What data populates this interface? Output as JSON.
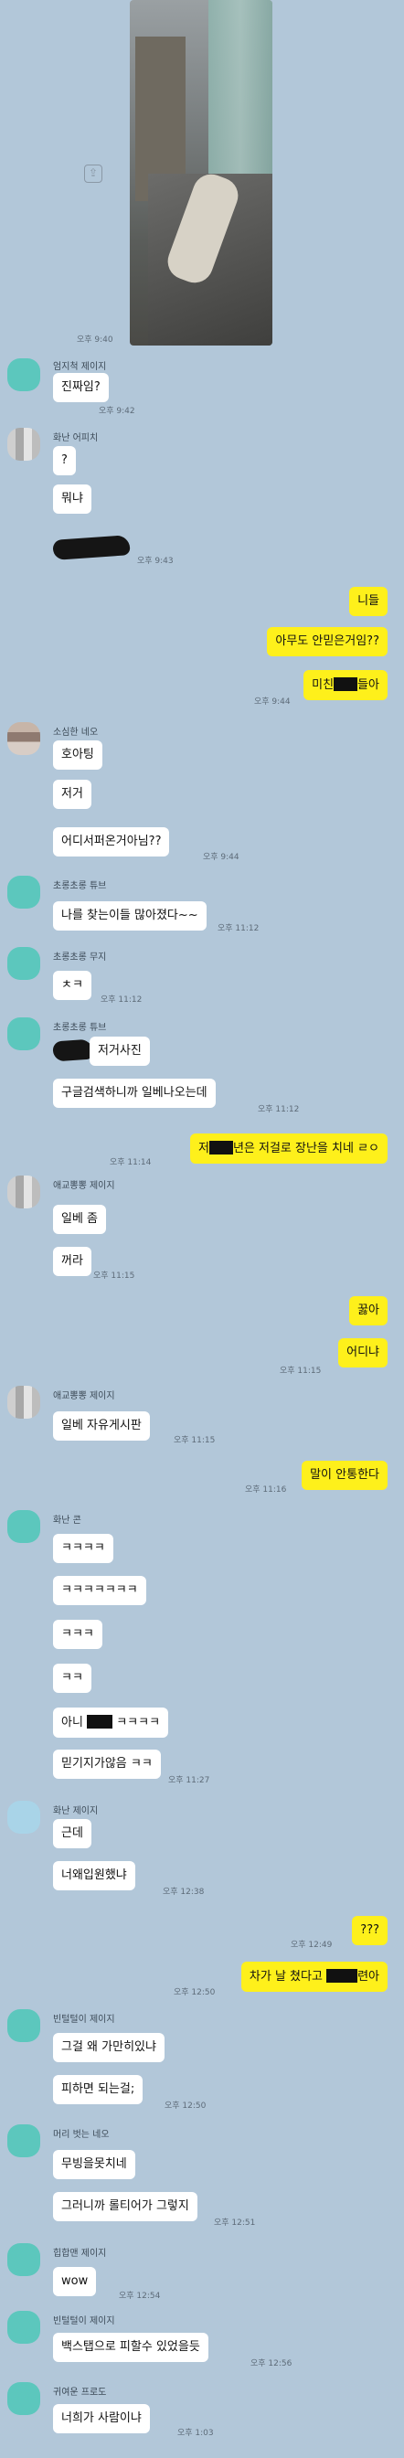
{
  "photo_time": "오후 9:40",
  "messages": [
    {
      "name": "엄지척 제이지",
      "bubbles": [
        "진짜임?"
      ],
      "time": "오후 9:42"
    },
    {
      "name": "화난 어피치",
      "bubbles": [
        "?",
        "뭐냐"
      ],
      "time": "오후 9:43"
    },
    {
      "mine": [
        "니들",
        "아무도 안믿은거임??",
        "미친",
        "들아"
      ],
      "time": "오후 9:44"
    },
    {
      "name": "소심한 네오",
      "bubbles": [
        "호아팅",
        "저거",
        "어디서퍼온거아님??"
      ],
      "time": "오후 9:44"
    },
    {
      "name": "초롱초롱 튜브",
      "bubbles": [
        "나를 찾는이들 많아졌다~~"
      ],
      "time": "오후 11:12"
    },
    {
      "name": "초롱초롱 무지",
      "bubbles": [
        "ㅊㅋ"
      ],
      "time": "오후 11:12"
    },
    {
      "name": "초롱초롱 튜브",
      "bubbles": [
        "저거사진",
        "구글검색하니까 일베나오는데"
      ],
      "time": "오후 11:12"
    },
    {
      "mine_time": "오후 11:14",
      "mine": [
        "저",
        "년은 저걸로 장난을 치네 ㄹㅇ"
      ]
    },
    {
      "name": "애교뽕뽕 제이지",
      "bubbles": [
        "일베 좀",
        "꺼라"
      ],
      "time": "오후 11:15"
    },
    {
      "mine": [
        "꿇아",
        "어디냐"
      ],
      "time": "오후 11:15"
    },
    {
      "name": "애교뽕뽕 제이지",
      "bubbles": [
        "일베 자유게시판"
      ],
      "time": "오후 11:15"
    },
    {
      "mine": [
        "말이 안통한다"
      ],
      "time": "오후 11:16"
    },
    {
      "name": "화난 콘",
      "bubbles": [
        "ㅋㅋㅋㅋ",
        "ㅋㅋㅋㅋㅋㅋㅋ",
        "ㅋㅋㅋ",
        "ㅋㅋ",
        "아니",
        "ㅋㅋㅋㅋ",
        "믿기지가않음 ㅋㅋ"
      ],
      "time": "오후 11:27"
    },
    {
      "name": "화난 제이지",
      "bubbles": [
        "근데",
        "너왜입원했냐"
      ],
      "time": "오후 12:38"
    },
    {
      "mine": [
        "???"
      ],
      "time": "오후 12:49"
    },
    {
      "mine": [
        "차가 날 쳤다고",
        "련아"
      ],
      "time": "오후 12:50"
    },
    {
      "name": "빈털털이 제이지",
      "bubbles": [
        "그걸 왜 가만히있냐",
        "피하면 되는걸;"
      ],
      "time": "오후 12:50"
    },
    {
      "name": "머리 벗는 네오",
      "bubbles": [
        "무빙을못치네",
        "그러니까 롤티어가 그렇지"
      ],
      "time": "오후 12:51"
    },
    {
      "name": "힙합맨 제이지",
      "bubbles": [
        "wow"
      ],
      "time": "오후 12:54"
    },
    {
      "name": "빈털털이 제이지",
      "bubbles": [
        "백스탭으로 피할수 있었을듯"
      ],
      "time": "오후 12:56"
    },
    {
      "name": "귀여운 프로도",
      "bubbles": [
        "너희가 사람이냐"
      ],
      "time": "오후 1:03"
    }
  ]
}
